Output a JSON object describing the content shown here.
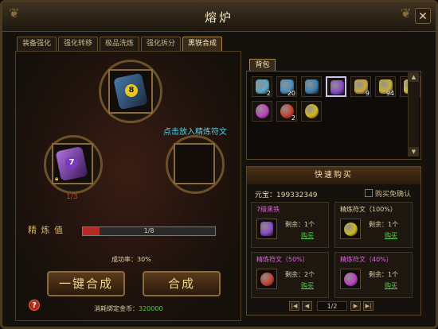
{
  "window": {
    "title": "熔炉",
    "close_label": "✕"
  },
  "tabs": [
    {
      "label": "装备强化"
    },
    {
      "label": "强化转移"
    },
    {
      "label": "极品洗炼"
    },
    {
      "label": "强化拆分"
    },
    {
      "label": "黑铁合成"
    }
  ],
  "forge": {
    "top_slot_number": "8",
    "left_slot_number": "7",
    "hint": "点击放入精炼符文",
    "left_count": "1/3",
    "refine_label": "精 炼 值",
    "progress_text": "1/8",
    "progress_fraction": 0.125,
    "success_rate": "成功率：30%",
    "one_click_button": "一键合成",
    "compose_button": "合成",
    "cost_label": "消耗绑定金币：",
    "cost_value": "320000",
    "help_label": "?"
  },
  "bag": {
    "tab_label": "背包",
    "items": [
      {
        "icon": "black-iron-gem-icon",
        "color": "#5aa8c8",
        "count": "2"
      },
      {
        "icon": "black-iron-gem-icon",
        "color": "#4a90c0",
        "count": "20"
      },
      {
        "icon": "black-iron-gem-icon",
        "color": "#3a80b8",
        "count": ""
      },
      {
        "icon": "black-iron-gem-icon",
        "color": "#8a4ac8",
        "count": "",
        "selected": true
      },
      {
        "icon": "black-iron-gem-icon",
        "color": "#c8a838",
        "count": "9"
      },
      {
        "icon": "black-iron-gem-icon",
        "color": "#c8b038",
        "count": "94"
      },
      {
        "icon": "black-iron-gem-icon",
        "color": "#d0c040",
        "count": ""
      },
      {
        "icon": "refine-rune-icon",
        "color": "#c040c0",
        "count": ""
      },
      {
        "icon": "refine-rune-icon",
        "color": "#c84030",
        "count": "2"
      },
      {
        "icon": "refine-rune-icon",
        "color": "#d0b820",
        "count": ""
      }
    ]
  },
  "quick_buy": {
    "header": "快速购买",
    "currency": "元宝：199332349",
    "confirm_label": "购买免确认",
    "items": [
      {
        "name": "7级黑铁",
        "name_color": "#e060e0",
        "remaining": "剩余：1个",
        "buy": "购买",
        "icon_color": "#8a4ac8"
      },
      {
        "name": "精炼符文（100%）",
        "name_color": "#e0d0a8",
        "remaining": "剩余：1个",
        "buy": "购买",
        "icon_color": "#d0b820"
      },
      {
        "name": "精炼符文（50%）",
        "name_color": "#e060e0",
        "remaining": "剩余：2个",
        "buy": "购买",
        "icon_color": "#c84030"
      },
      {
        "name": "精炼符文（40%）",
        "name_color": "#e060e0",
        "remaining": "剩余：1个",
        "buy": "购买",
        "icon_color": "#c040c0"
      }
    ],
    "page": "1/2"
  }
}
